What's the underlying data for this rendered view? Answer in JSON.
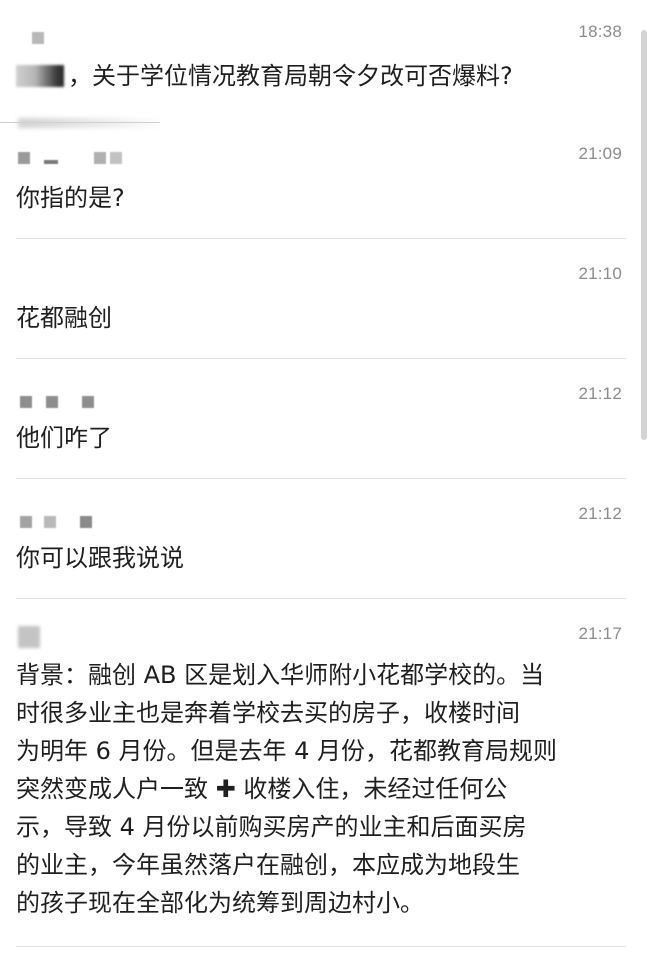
{
  "messages": [
    {
      "time": "18:38",
      "text": "，关于学位情况教育局朝令夕改可否爆料?"
    },
    {
      "time": "21:09",
      "text": "你指的是?"
    },
    {
      "time": "21:10",
      "text": "花都融创"
    },
    {
      "time": "21:12",
      "text": "他们咋了"
    },
    {
      "time": "21:12",
      "text": "你可以跟我说说"
    },
    {
      "time": "21:17",
      "lines": [
        "背景：融创 AB 区是划入华师附小花都学校的。当",
        "时很多业主也是奔着学校去买的房子，收楼时间",
        "为明年 6 月份。但是去年 4 月份，花都教育局规则",
        "突然变成人户一致 ✚ 收楼入住，未经过任何公",
        "示，导致 4 月份以前购买房产的业主和后面买房",
        "的业主，今年虽然落户在融创，本应成为地段生",
        "的孩子现在全部化为统筹到周边村小。"
      ]
    }
  ]
}
